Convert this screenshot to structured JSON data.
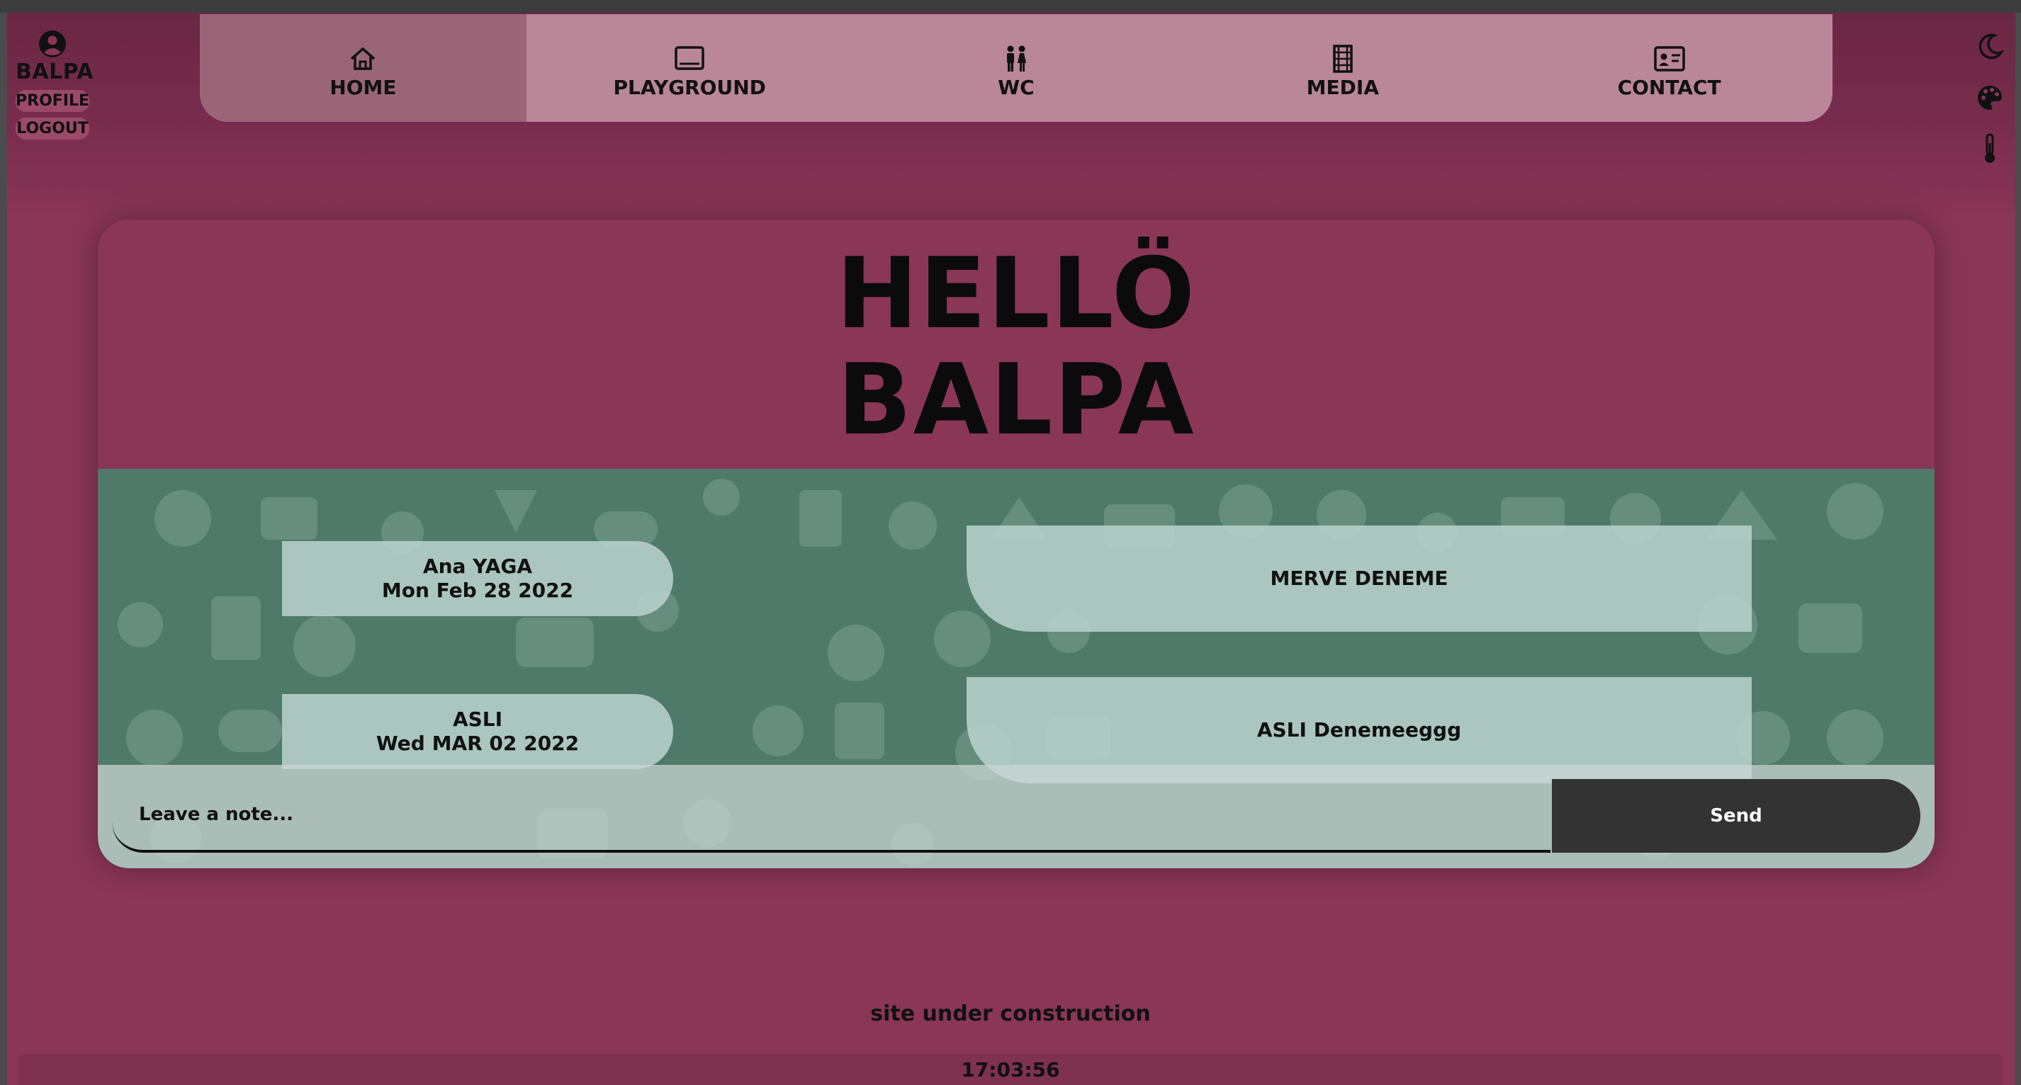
{
  "user": {
    "name": "BALPA",
    "profile_label": "PROFILE",
    "logout_label": "LOGOUT"
  },
  "nav": {
    "items": [
      {
        "label": "Home",
        "icon": "home-icon"
      },
      {
        "label": "PLAYGROUND",
        "icon": "monitor-icon"
      },
      {
        "label": "WC",
        "icon": "restroom-icon"
      },
      {
        "label": "Media",
        "icon": "film-icon"
      },
      {
        "label": "CONTACT",
        "icon": "contact-card-icon"
      }
    ]
  },
  "side_icons": [
    "moon-icon",
    "palette-icon",
    "thermometer-icon"
  ],
  "greeting": {
    "line1": "HELLÖ",
    "line2": "BALPA"
  },
  "messages_left": [
    {
      "name": "Ana YAGA",
      "date": "Mon Feb 28 2022"
    },
    {
      "name": "ASLI",
      "date": "Wed MAR 02 2022"
    }
  ],
  "messages_right": [
    {
      "text": "MERVE DENEME"
    },
    {
      "text": "ASLI Denemeeggg"
    }
  ],
  "composer": {
    "placeholder": "Leave a note...",
    "send_label": "Send"
  },
  "footer": {
    "status": "site under construction",
    "time": "17:03:56"
  },
  "colors": {
    "background": "#8a3656",
    "nav": "#b98798",
    "chat": "#4f7a6a",
    "send": "#333333"
  }
}
